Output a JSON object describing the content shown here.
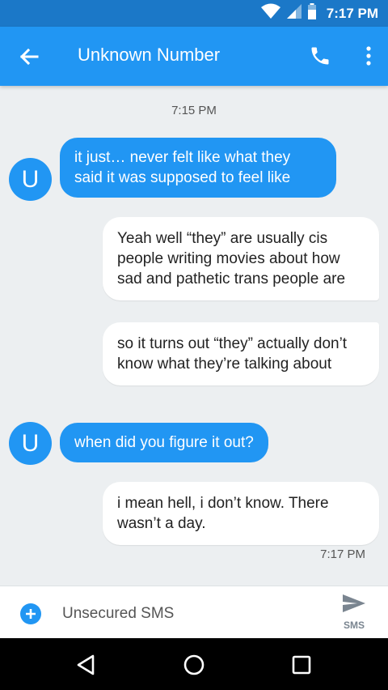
{
  "status_bar": {
    "time": "7:17 PM"
  },
  "app_bar": {
    "title": "Unknown Number"
  },
  "conversation": {
    "timestamp_top": "7:15 PM",
    "avatar_letter": "U",
    "messages": [
      {
        "direction": "incoming",
        "text": "it just… never felt like what they said it was supposed to feel like"
      },
      {
        "direction": "outgoing",
        "text": "Yeah well “they” are usually cis people writing movies about how sad and pathetic trans people are"
      },
      {
        "direction": "outgoing",
        "text": "so it turns out “they” actually don’t know what they’re talking about"
      },
      {
        "direction": "incoming",
        "text": "when did you figure it out?"
      },
      {
        "direction": "outgoing",
        "text": "i mean hell, i don’t know. There wasn’t a day."
      }
    ],
    "timestamp_bottom": "7:17 PM"
  },
  "composer": {
    "placeholder": "Unsecured SMS",
    "send_label": "SMS"
  },
  "colors": {
    "accent": "#2196f3",
    "status_bar": "#1b78c8",
    "background": "#eceff1"
  }
}
